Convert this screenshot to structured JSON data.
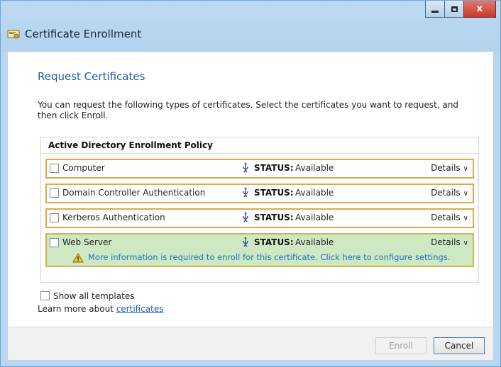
{
  "window": {
    "title": "Certificate Enrollment",
    "controls": {
      "minimize": "minimize",
      "maximize": "maximize",
      "close": "x"
    }
  },
  "page": {
    "heading": "Request Certificates",
    "intro": "You can request the following types of certificates. Select the certificates you want to request, and then click Enroll."
  },
  "policy": {
    "header": "Active Directory Enrollment Policy",
    "status_label": "STATUS:",
    "details_label": "Details",
    "items": [
      {
        "name": "Computer",
        "status": "Available",
        "checked": false
      },
      {
        "name": "Domain Controller Authentication",
        "status": "Available",
        "checked": false
      },
      {
        "name": "Kerberos Authentication",
        "status": "Available",
        "checked": false
      },
      {
        "name": "Web Server",
        "status": "Available",
        "checked": false,
        "warning": "More information is required to enroll for this certificate. Click here to configure settings."
      }
    ]
  },
  "options": {
    "show_all_templates": "Show all templates",
    "learn_more_prefix": "Learn more about",
    "learn_more_link": "certificates"
  },
  "buttons": {
    "enroll": "Enroll",
    "cancel": "Cancel"
  },
  "colors": {
    "selection_border": "#e4a64a",
    "selected_row_bg": "#cfe8c4",
    "link": "#1e5fa8",
    "heading": "#1e5fa8"
  },
  "icons": [
    "certificate-wizard-icon",
    "info-status-icon",
    "warning-icon",
    "chevron-down-icon"
  ]
}
